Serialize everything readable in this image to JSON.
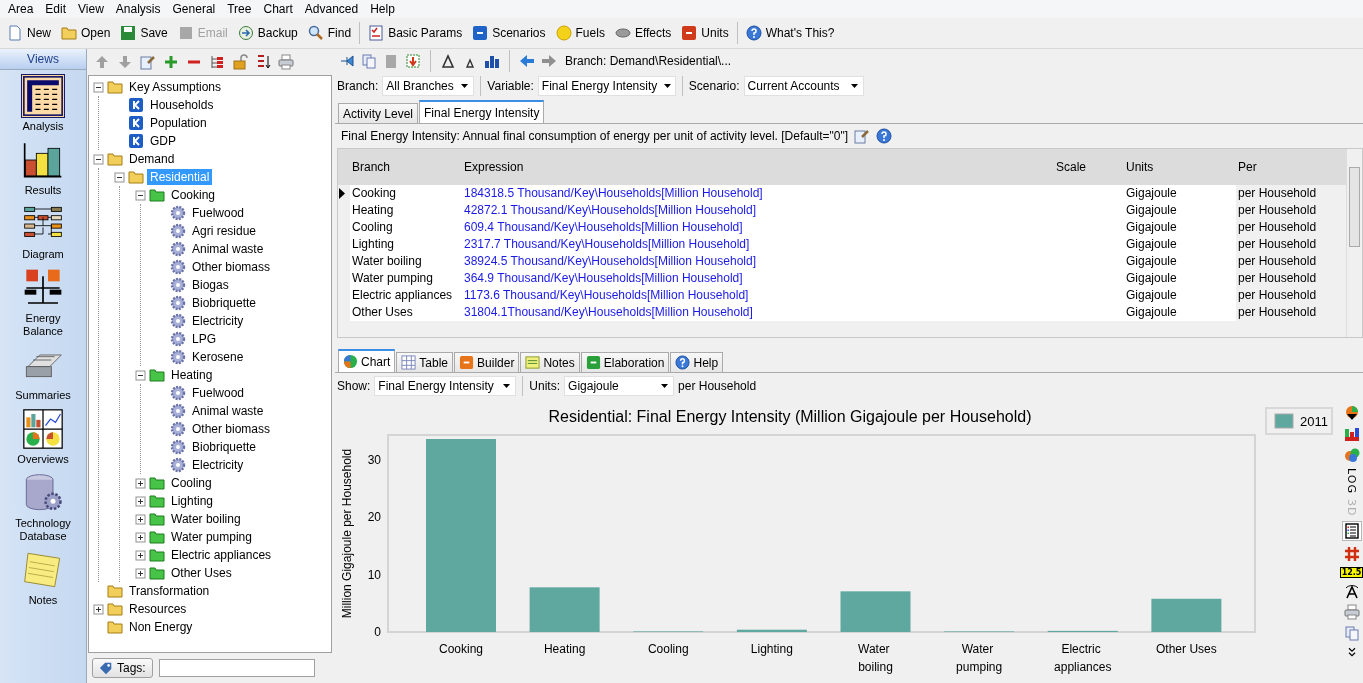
{
  "menu": [
    "Area",
    "Edit",
    "View",
    "Analysis",
    "General",
    "Tree",
    "Chart",
    "Advanced",
    "Help"
  ],
  "toolbar": [
    {
      "label": "New",
      "disabled": false
    },
    {
      "label": "Open",
      "disabled": false
    },
    {
      "label": "Save",
      "disabled": false
    },
    {
      "label": "Email",
      "disabled": true
    },
    {
      "label": "Backup",
      "disabled": false
    },
    {
      "label": "Find",
      "disabled": false
    },
    {
      "label": "Basic Params",
      "disabled": false
    },
    {
      "label": "Scenarios",
      "disabled": false
    },
    {
      "label": "Fuels",
      "disabled": false
    },
    {
      "label": "Effects",
      "disabled": false
    },
    {
      "label": "Units",
      "disabled": false
    },
    {
      "label": "What's This?",
      "disabled": false
    }
  ],
  "views": {
    "title": "Views",
    "items": [
      {
        "label": "Analysis",
        "selected": true
      },
      {
        "label": "Results",
        "selected": false
      },
      {
        "label": "Diagram",
        "selected": false
      },
      {
        "label": "Energy Balance",
        "selected": false
      },
      {
        "label": "Summaries",
        "selected": false
      },
      {
        "label": "Overviews",
        "selected": false
      },
      {
        "label": "Technology Database",
        "selected": false
      },
      {
        "label": "Notes",
        "selected": false
      }
    ]
  },
  "tree": [
    {
      "label": "Key Assumptions",
      "kind": "folder",
      "expanded": true,
      "selected": false,
      "children": [
        {
          "label": "Households",
          "kind": "key",
          "selected": false
        },
        {
          "label": "Population",
          "kind": "key",
          "selected": false
        },
        {
          "label": "GDP",
          "kind": "key",
          "selected": false
        }
      ]
    },
    {
      "label": "Demand",
      "kind": "folder",
      "expanded": true,
      "selected": false,
      "children": [
        {
          "label": "Residential",
          "kind": "folder",
          "expanded": true,
          "selected": true,
          "children": [
            {
              "label": "Cooking",
              "kind": "category",
              "expanded": true,
              "selected": false,
              "children": [
                {
                  "label": "Fuelwood",
                  "kind": "gear",
                  "selected": false
                },
                {
                  "label": "Agri residue",
                  "kind": "gear",
                  "selected": false
                },
                {
                  "label": "Animal waste",
                  "kind": "gear",
                  "selected": false
                },
                {
                  "label": "Other biomass",
                  "kind": "gear",
                  "selected": false
                },
                {
                  "label": "Biogas",
                  "kind": "gear",
                  "selected": false
                },
                {
                  "label": "Biobriquette",
                  "kind": "gear",
                  "selected": false
                },
                {
                  "label": "Electricity",
                  "kind": "gear",
                  "selected": false
                },
                {
                  "label": "LPG",
                  "kind": "gear",
                  "selected": false
                },
                {
                  "label": "Kerosene",
                  "kind": "gear",
                  "selected": false
                }
              ]
            },
            {
              "label": "Heating",
              "kind": "category",
              "expanded": true,
              "selected": false,
              "children": [
                {
                  "label": "Fuelwood",
                  "kind": "gear",
                  "selected": false
                },
                {
                  "label": "Animal waste",
                  "kind": "gear",
                  "selected": false
                },
                {
                  "label": "Other biomass",
                  "kind": "gear",
                  "selected": false
                },
                {
                  "label": "Biobriquette",
                  "kind": "gear",
                  "selected": false
                },
                {
                  "label": "Electricity",
                  "kind": "gear",
                  "selected": false
                }
              ]
            },
            {
              "label": "Cooling",
              "kind": "category",
              "expanded": false,
              "selected": false
            },
            {
              "label": "Lighting",
              "kind": "category",
              "expanded": false,
              "selected": false
            },
            {
              "label": "Water boiling",
              "kind": "category",
              "expanded": false,
              "selected": false
            },
            {
              "label": "Water pumping",
              "kind": "category",
              "expanded": false,
              "selected": false
            },
            {
              "label": "Electric appliances",
              "kind": "category",
              "expanded": false,
              "selected": false
            },
            {
              "label": "Other Uses",
              "kind": "category",
              "expanded": false,
              "selected": false
            }
          ]
        }
      ]
    },
    {
      "label": "Transformation",
      "kind": "folder",
      "selected": false
    },
    {
      "label": "Resources",
      "kind": "folder",
      "expanded": false,
      "selected": false
    },
    {
      "label": "Non Energy",
      "kind": "folder",
      "selected": false
    }
  ],
  "tags": {
    "label": "Tags:"
  },
  "editor": {
    "breadcrumb": "Branch: Demand\\Residential\\...",
    "filters": [
      {
        "label": "Branch:",
        "value": "All Branches"
      },
      {
        "label": "Variable:",
        "value": "Final Energy Intensity"
      },
      {
        "label": "Scenario:",
        "value": "Current Accounts"
      }
    ],
    "tabs": [
      {
        "label": "Activity Level",
        "selected": false
      },
      {
        "label": "Final Energy Intensity",
        "selected": true
      }
    ],
    "description": "Final Energy Intensity: Annual final consumption of energy per unit of activity level. [Default=\"0\"]",
    "table": {
      "columns": [
        "Branch",
        "Expression",
        "Scale",
        "Units",
        "Per"
      ],
      "rows": [
        {
          "branch": "Cooking",
          "expression": "184318.5 Thousand/Key\\Households[Million Household]",
          "units": "Gigajoule",
          "per": "per Household",
          "current": true
        },
        {
          "branch": "Heating",
          "expression": "42872.1 Thousand/Key\\Households[Million Household]",
          "units": "Gigajoule",
          "per": "per Household",
          "current": false
        },
        {
          "branch": "Cooling",
          "expression": "609.4 Thousand/Key\\Households[Million Household]",
          "units": "Gigajoule",
          "per": "per Household",
          "current": false
        },
        {
          "branch": "Lighting",
          "expression": "2317.7 Thousand/Key\\Households[Million Household]",
          "units": "Gigajoule",
          "per": "per Household",
          "current": false
        },
        {
          "branch": "Water boiling",
          "expression": "38924.5 Thousand/Key\\Households[Million Household]",
          "units": "Gigajoule",
          "per": "per Household",
          "current": false
        },
        {
          "branch": "Water pumping",
          "expression": "364.9 Thousand/Key\\Households[Million Household]",
          "units": "Gigajoule",
          "per": "per Household",
          "current": false
        },
        {
          "branch": "Electric appliances",
          "expression": "1173.6 Thousand/Key\\Households[Million Household]",
          "units": "Gigajoule",
          "per": "per Household",
          "current": false
        },
        {
          "branch": "Other Uses",
          "expression": "31804.1Thousand/Key\\Households[Million Household]",
          "units": "Gigajoule",
          "per": "per Household",
          "current": false
        }
      ]
    }
  },
  "results": {
    "tabs": [
      {
        "label": "Chart",
        "selected": true
      },
      {
        "label": "Table",
        "selected": false
      },
      {
        "label": "Builder",
        "selected": false
      },
      {
        "label": "Notes",
        "selected": false
      },
      {
        "label": "Elaboration",
        "selected": false
      },
      {
        "label": "Help",
        "selected": false
      }
    ],
    "show": {
      "label": "Show:",
      "value": "Final Energy Intensity"
    },
    "units": {
      "label": "Units:",
      "value": "Gigajoule"
    },
    "per": "per Household",
    "chart_data": {
      "type": "bar",
      "title": "Residential: Final Energy Intensity (Million Gigajoule per Household)",
      "ylabel": "Million Gigajoule per Household",
      "categories": [
        "Cooking",
        "Heating",
        "Cooling",
        "Lighting",
        "Water boiling",
        "Water pumping",
        "Electric appliances",
        "Other Uses"
      ],
      "series": [
        {
          "name": "2011",
          "color": "#5fa8a0",
          "values": [
            33.7,
            7.8,
            0.1,
            0.4,
            7.1,
            0.1,
            0.2,
            5.8
          ]
        }
      ],
      "ylim": [
        0,
        34.4
      ],
      "yticks": [
        0,
        10,
        20,
        30
      ]
    },
    "side_toolbar": {
      "log": {
        "label": "LOG",
        "disabled": false
      },
      "three_d": {
        "label": "3D",
        "disabled": true
      },
      "legend": {
        "selected": true
      },
      "value_label": "12.5"
    }
  }
}
